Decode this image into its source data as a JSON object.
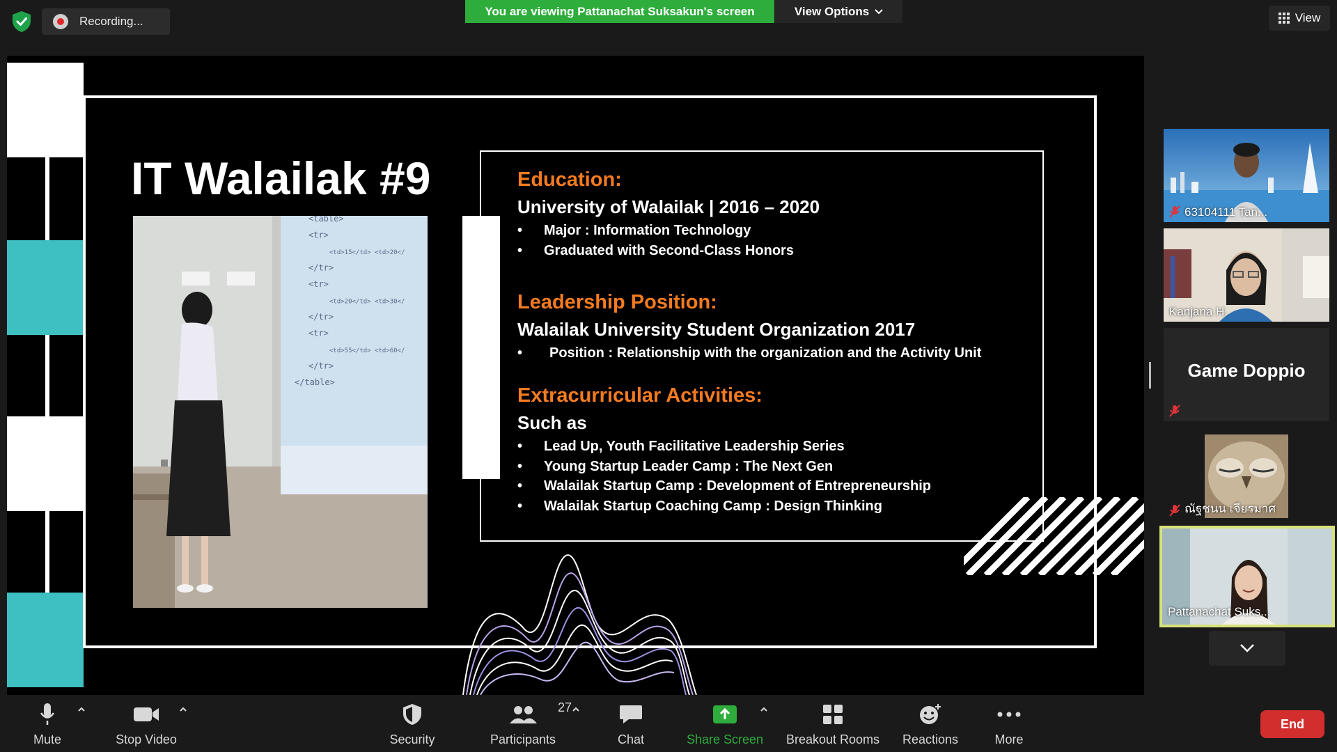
{
  "top_bar": {
    "recording_label": "Recording...",
    "viewing_banner": "You are viewing Pattanachat Suksakun's screen",
    "view_options_label": "View Options",
    "view_label": "View"
  },
  "slide": {
    "title": "IT Walailak #9",
    "education": {
      "heading": "Education:",
      "subheading": "University of Walailak |  2016 – 2020",
      "items": [
        "Major : Information Technology",
        "Graduated with Second-Class Honors"
      ]
    },
    "leadership": {
      "heading": "Leadership Position:",
      "subheading": "Walailak University Student Organization 2017",
      "items": [
        "Position : Relationship with the organization and the Activity Unit"
      ]
    },
    "extracurricular": {
      "heading": "Extracurricular Activities:",
      "subheading": "Such as",
      "items": [
        "Lead Up, Youth Facilitative Leadership Series",
        "Young Startup Leader Camp : The Next Gen",
        "Walailak Startup Camp : Development of Entrepreneurship",
        "Walailak Startup Coaching Camp : Design Thinking"
      ]
    },
    "photo_code_lines": [
      "<table>",
      "<tr>",
      "<td>15</td> <td>20</",
      "</tr>",
      "<tr>",
      "<td>20</td> <td>30</",
      "</tr>",
      "<tr>",
      "<td>55</td> <td>60</",
      "</tr>",
      "</table>"
    ],
    "bullet_char": "•"
  },
  "participants_panel": {
    "tiles": [
      {
        "name": "63104111 Tan...",
        "muted": true
      },
      {
        "name": "Kanjana H.",
        "muted": false
      },
      {
        "name": "Game Doppio",
        "muted": true
      },
      {
        "name": "ณัฐชนน เจียรมาศ",
        "muted": true
      },
      {
        "name": "Pattanachat Suks...",
        "muted": false,
        "active": true
      }
    ]
  },
  "toolbar": {
    "mute": "Mute",
    "stop_video": "Stop Video",
    "security": "Security",
    "participants": "Participants",
    "participants_count": "27",
    "chat": "Chat",
    "share_screen": "Share Screen",
    "breakout_rooms": "Breakout Rooms",
    "reactions": "Reactions",
    "more": "More",
    "end": "End"
  },
  "colors": {
    "accent_green": "#2ead3c",
    "slide_orange": "#f47b20",
    "slide_teal": "#3ebfc2",
    "end_red": "#d32e2e",
    "active_speaker": "#d6e27a"
  }
}
